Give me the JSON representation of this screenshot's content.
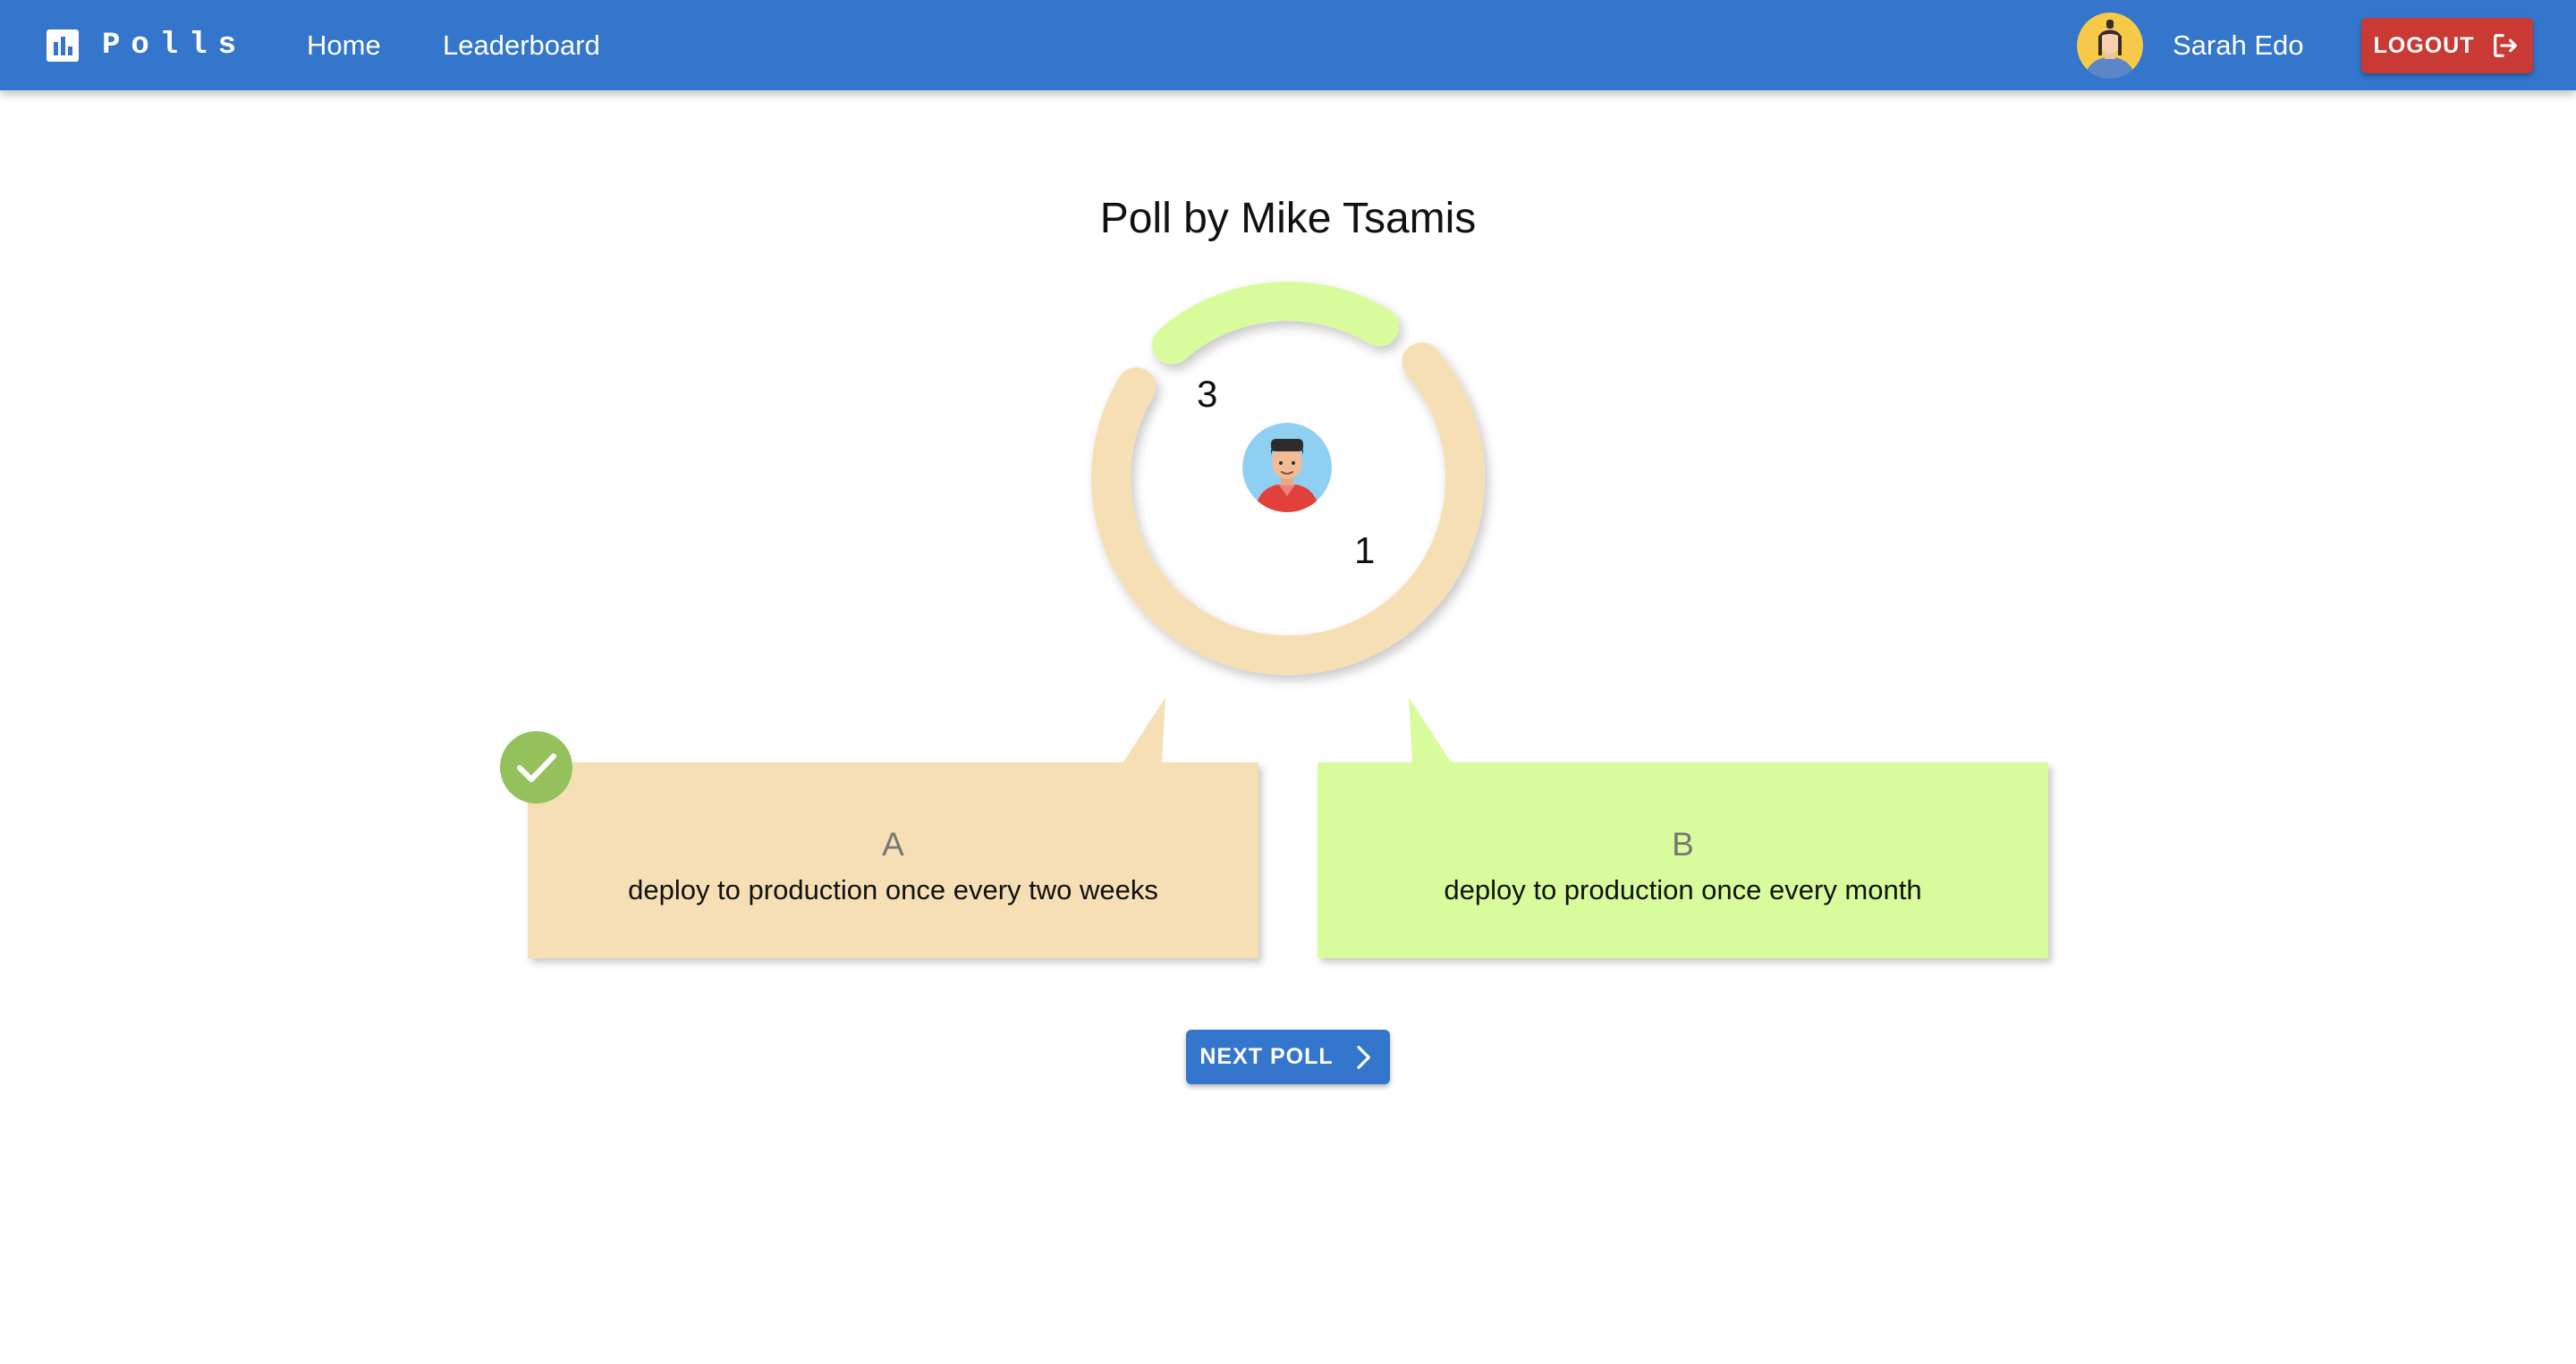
{
  "header": {
    "app_name": "Polls",
    "app_icon": "bar-chart-icon",
    "nav": [
      {
        "label": "Home"
      },
      {
        "label": "Leaderboard"
      }
    ],
    "user_name": "Sarah Edo",
    "logout_label": "LOGOUT",
    "logout_icon": "logout-icon",
    "bar_color": "#3476cc",
    "logout_color": "#c93a34"
  },
  "poll": {
    "title": "Poll by Mike Tsamis",
    "votes": {
      "option_a": 3,
      "option_b": 1
    },
    "options": [
      {
        "letter": "A",
        "text": "deploy to production once every two weeks",
        "color": "#f7dfb5",
        "selected": true
      },
      {
        "letter": "B",
        "text": "deploy to production once every month",
        "color": "#d8fc9b",
        "selected": false
      }
    ],
    "selected_icon": "checkmark-icon",
    "selected_badge_color": "#94c15b"
  },
  "actions": {
    "next_label": "NEXT POLL",
    "next_icon": "chevron-right-icon"
  }
}
